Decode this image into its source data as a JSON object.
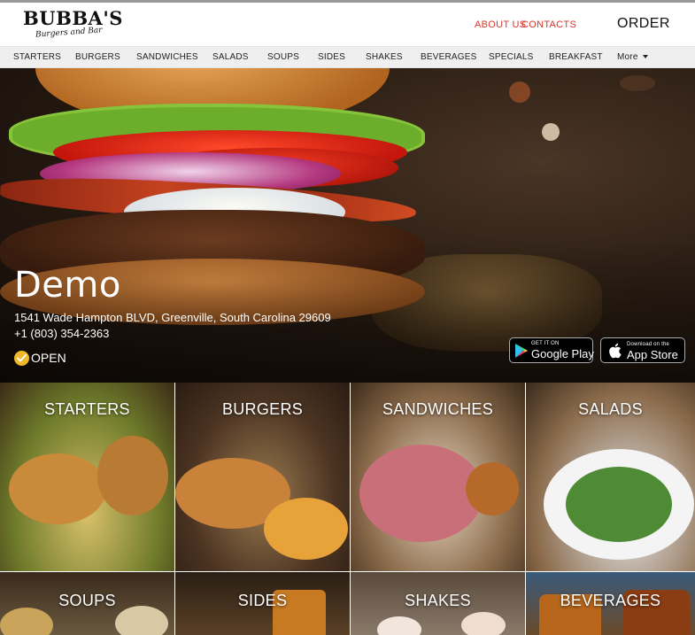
{
  "header": {
    "logo_main": "BUBBA'S",
    "logo_sub": "Burgers and Bar",
    "links": [
      "ABOUT US",
      "CONTACTS"
    ],
    "order_label": "ORDER"
  },
  "nav": {
    "items": [
      "STARTERS",
      "BURGERS",
      "SANDWICHES",
      "SALADS",
      "SOUPS",
      "SIDES",
      "SHAKES",
      "BEVERAGES",
      "SPECIALS",
      "BREAKFAST"
    ],
    "more_label": "More"
  },
  "hero": {
    "title": "Demo",
    "address": "1541 Wade Hampton BLVD, Greenville, South Carolina 29609",
    "phone": "+1 (803) 354-2363",
    "status": "OPEN",
    "google_play": {
      "small": "GET IT ON",
      "big": "Google Play"
    },
    "app_store": {
      "small": "Download on the",
      "big": "App Store"
    }
  },
  "categories": [
    "STARTERS",
    "BURGERS",
    "SANDWICHES",
    "SALADS",
    "SOUPS",
    "SIDES",
    "SHAKES",
    "BEVERAGES"
  ],
  "colors": {
    "accent_link": "#d9342b",
    "open_check": "#f1b829",
    "nav_bg": "#efefef"
  }
}
